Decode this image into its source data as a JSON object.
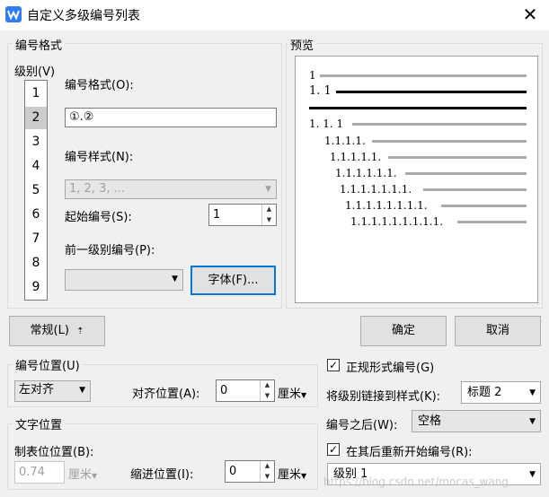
{
  "window": {
    "title": "自定义多级编号列表",
    "close_glyph": "✕"
  },
  "number_format_group": {
    "legend": "编号格式",
    "level_label": "级别(V)",
    "levels": [
      "1",
      "2",
      "3",
      "4",
      "5",
      "6",
      "7",
      "8",
      "9"
    ],
    "selected_level": "2",
    "format_label": "编号格式(O):",
    "format_value": "①.②",
    "style_label": "编号样式(N):",
    "style_value": "1, 2, 3, ...",
    "start_label": "起始编号(S):",
    "start_value": "1",
    "prev_level_label": "前一级别编号(P):",
    "prev_level_value": "",
    "font_button": "字体(F)..."
  },
  "preview": {
    "legend": "预览",
    "lines": [
      "1",
      "1. 1",
      "",
      "1. 1. 1",
      "1.1.1.1.",
      "1.1.1.1.1.",
      "1.1.1.1.1.1.",
      "1.1.1.1.1.1.1.",
      "1.1.1.1.1.1.1.1.",
      "1.1.1.1.1.1.1.1.1."
    ]
  },
  "buttons": {
    "general": "常规(L)",
    "general_arrow": "⇡",
    "ok": "确定",
    "cancel": "取消"
  },
  "number_position": {
    "legend": "编号位置(U)",
    "align_value": "左对齐",
    "align_pos_label": "对齐位置(A):",
    "align_pos_value": "0",
    "unit": "厘米"
  },
  "text_position": {
    "legend": "文字位置",
    "tab_label": "制表位位置(B):",
    "tab_value": "0.74",
    "tab_unit": "厘米",
    "indent_label": "缩进位置(I):",
    "indent_value": "0",
    "indent_unit": "厘米"
  },
  "right_options": {
    "legal_label": "正规形式编号(G)",
    "legal_checked": true,
    "link_label": "将级别链接到样式(K):",
    "link_value": "标题 2",
    "after_label": "编号之后(W):",
    "after_value": "空格",
    "restart_label": "在其后重新开始编号(R):",
    "restart_checked": true,
    "restart_value": "级别 1"
  },
  "watermark": "https://blog.csdn.net/mocas_wang"
}
